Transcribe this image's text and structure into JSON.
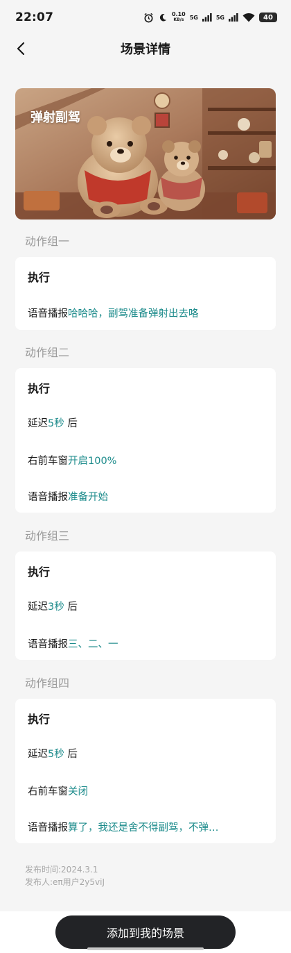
{
  "status_bar": {
    "time": "22:07",
    "speed_value": "0.10",
    "speed_unit": "KB/s",
    "net1": "5G",
    "net2": "5G",
    "battery": "40"
  },
  "nav": {
    "title": "场景详情"
  },
  "banner": {
    "title": "弹射副驾"
  },
  "groups": [
    {
      "label": "动作组一",
      "head": "执行",
      "rows": [
        {
          "prefix": "语音播报",
          "value": "哈哈哈，副驾准备弹射出去咯",
          "suffix": ""
        }
      ]
    },
    {
      "label": "动作组二",
      "head": "执行",
      "rows": [
        {
          "prefix": "延迟",
          "value": "5秒",
          "suffix": " 后"
        },
        {
          "prefix": "右前车窗",
          "value": "开启100%",
          "suffix": ""
        },
        {
          "prefix": "语音播报",
          "value": "准备开始",
          "suffix": ""
        }
      ]
    },
    {
      "label": "动作组三",
      "head": "执行",
      "rows": [
        {
          "prefix": "延迟",
          "value": "3秒",
          "suffix": " 后"
        },
        {
          "prefix": "语音播报",
          "value": "三、二、一",
          "suffix": ""
        }
      ]
    },
    {
      "label": "动作组四",
      "head": "执行",
      "rows": [
        {
          "prefix": "延迟",
          "value": "5秒",
          "suffix": " 后"
        },
        {
          "prefix": "右前车窗",
          "value": "关闭",
          "suffix": ""
        },
        {
          "prefix": "语音播报",
          "value": "算了，我还是舍不得副驾，不弹…",
          "suffix": ""
        }
      ]
    }
  ],
  "meta": {
    "publish_time": "发布时间:2024.3.1",
    "publisher": "发布人:eπ用户2y5viJ"
  },
  "add_button": "添加到我的场景",
  "colors": {
    "accent": "#1a8a8a",
    "button_bg": "#222326",
    "page_bg": "#f5f5f5"
  },
  "icons": [
    "back-arrow-icon",
    "alarm-icon",
    "moon-icon",
    "signal-icon",
    "wifi-icon",
    "battery-icon"
  ]
}
